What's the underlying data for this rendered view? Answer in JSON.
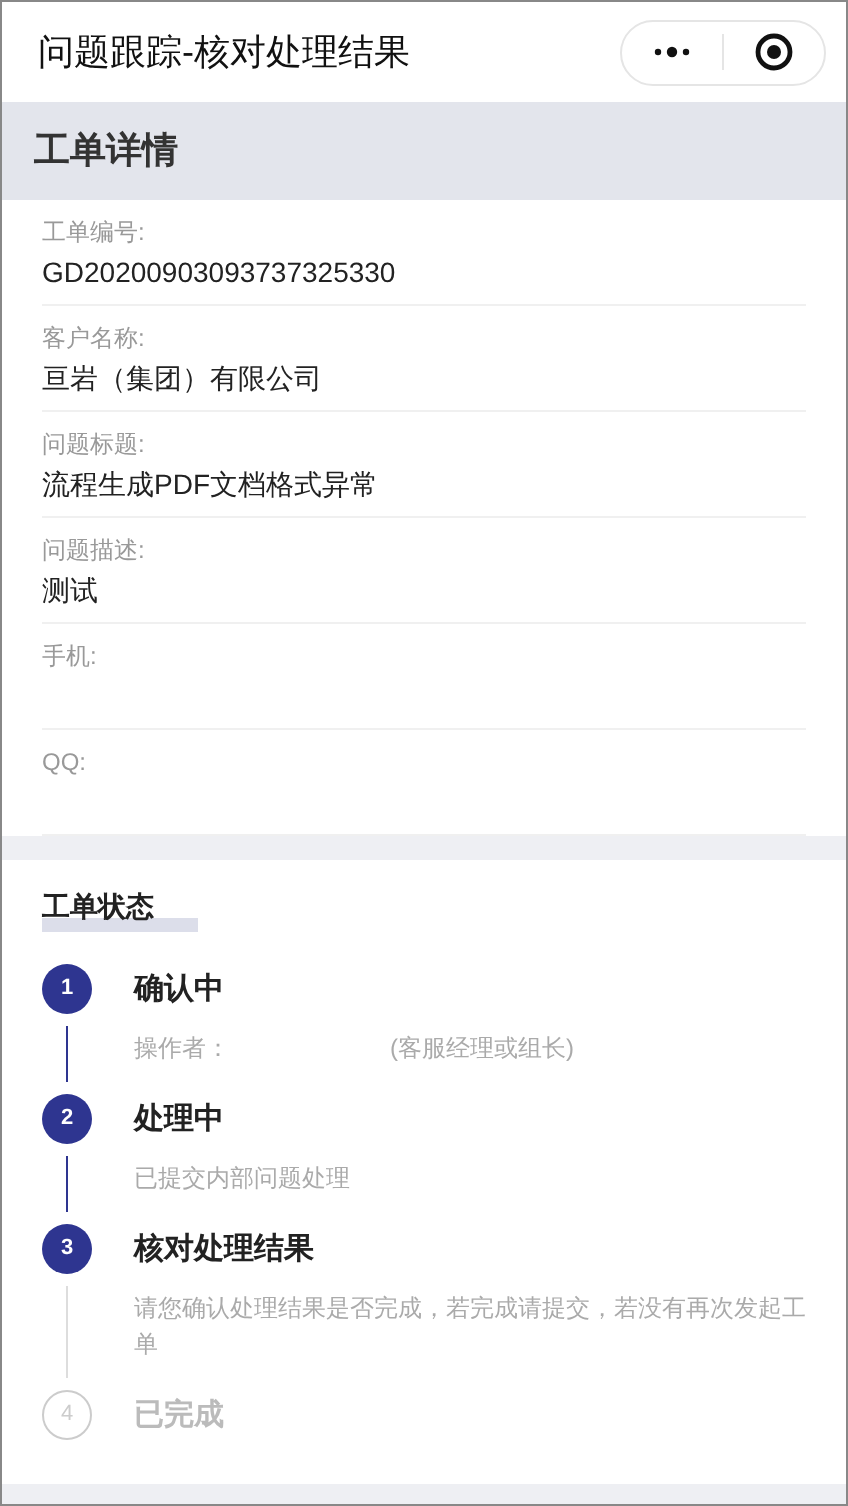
{
  "nav_bar": {
    "title": "问题跟踪-核对处理结果"
  },
  "detail_header": {
    "title": "工单详情"
  },
  "fields": [
    {
      "label": "工单编号:",
      "value": "GD20200903093737325330"
    },
    {
      "label": "客户名称:",
      "value": "亘岩（集团）有限公司"
    },
    {
      "label": "问题标题:",
      "value": "流程生成PDF文档格式异常"
    },
    {
      "label": "问题描述:",
      "value": "测试"
    },
    {
      "label": "手机:"
    },
    {
      "label": "QQ:"
    }
  ],
  "status_section": {
    "title": "工单状态"
  },
  "steps": [
    {
      "number": "1",
      "title": "确认中",
      "done": true,
      "description": [
        "操作者：",
        "(客服经理或组长)"
      ]
    },
    {
      "number": "2",
      "title": "处理中",
      "done": true,
      "description": [
        "已提交内部问题处理"
      ]
    },
    {
      "number": "3",
      "title": "核对处理结果",
      "done": true,
      "description": [
        "请您确认处理结果是否完成，若完成请提交，若没有再次发起工单"
      ]
    },
    {
      "number": "4",
      "title": "已完成",
      "done": false
    }
  ]
}
